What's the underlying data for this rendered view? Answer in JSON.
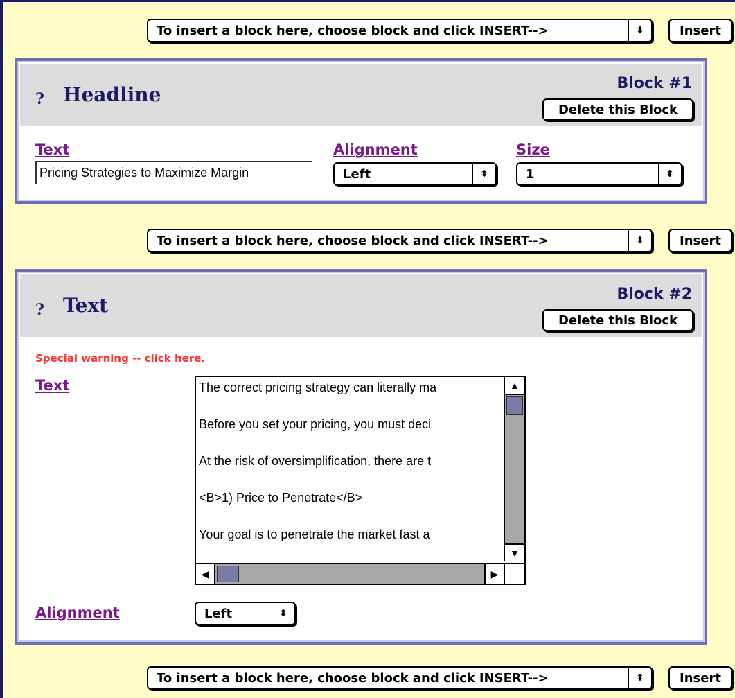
{
  "insert_bar": {
    "select_value": "To insert a block here, choose block and click INSERT-->",
    "button_label": "Insert"
  },
  "blocks": [
    {
      "help_icon": "?",
      "title": "Headline",
      "block_number": "Block #1",
      "delete_label": "Delete this Block",
      "fields": {
        "text_label": "Text",
        "text_value": "Pricing Strategies to Maximize Margin",
        "alignment_label": "Alignment",
        "alignment_value": "Left",
        "size_label": "Size",
        "size_value": "1"
      }
    },
    {
      "help_icon": "?",
      "title": "Text",
      "block_number": "Block #2",
      "delete_label": "Delete this Block",
      "warning_link": "Special warning -- click here.",
      "fields": {
        "text_label": "Text",
        "text_lines": [
          "The correct pricing strategy can literally ma",
          "Before you set your pricing, you must deci",
          "At the risk of oversimplification, there are t",
          "<B>1) Price to Penetrate</B>",
          "Your goal is to penetrate the market fast a"
        ],
        "alignment_label": "Alignment",
        "alignment_value": "Left"
      }
    }
  ],
  "icons": {
    "select_arrows": "⬍",
    "scroll_up": "▲",
    "scroll_down": "▼",
    "scroll_left": "◀",
    "scroll_right": "▶"
  },
  "colors": {
    "page_background": "#fffcc8",
    "block_border": "#6e6eb8",
    "block_header": "#dcdcdc",
    "title_text": "#1a1a66",
    "field_label": "#7a1a8a",
    "warning": "#ff3333"
  }
}
